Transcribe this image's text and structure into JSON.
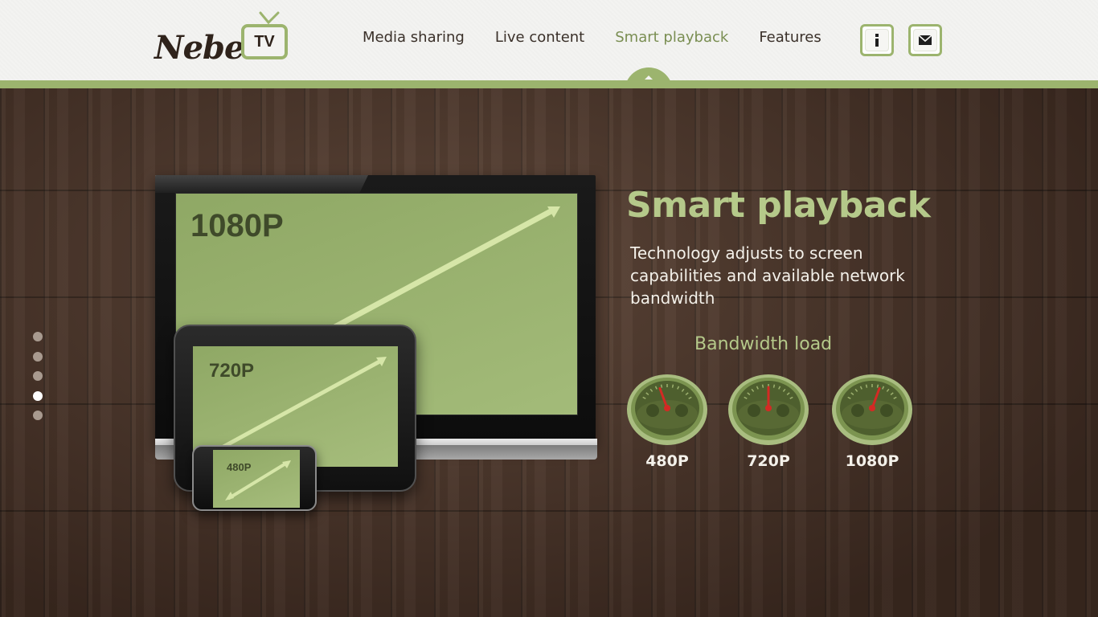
{
  "brand": {
    "logo_text": "Nebel.",
    "logo_badge": "TV"
  },
  "nav": {
    "items": [
      {
        "label": "Media sharing"
      },
      {
        "label": "Live content"
      },
      {
        "label": "Smart playback",
        "active": true
      },
      {
        "label": "Features"
      }
    ]
  },
  "header_icons": {
    "info": "info-icon",
    "mail": "mail-icon"
  },
  "colors": {
    "accent": "#9cb46e",
    "heading": "#b5c98a",
    "screen": "#9cb46e",
    "needle": "#d42a24"
  },
  "devices": {
    "tv": {
      "resolution": "1080P"
    },
    "tablet": {
      "resolution": "720P"
    },
    "phone": {
      "resolution": "480P"
    }
  },
  "section": {
    "title": "Smart playback",
    "description": "Technology adjusts to screen capabilities and available network bandwidth"
  },
  "bandwidth": {
    "title": "Bandwidth load",
    "gauges": [
      {
        "label": "480P",
        "level": 0.35
      },
      {
        "label": "720P",
        "level": 0.5
      },
      {
        "label": "1080P",
        "level": 0.65
      }
    ]
  },
  "slider": {
    "count": 5,
    "active_index": 3
  }
}
